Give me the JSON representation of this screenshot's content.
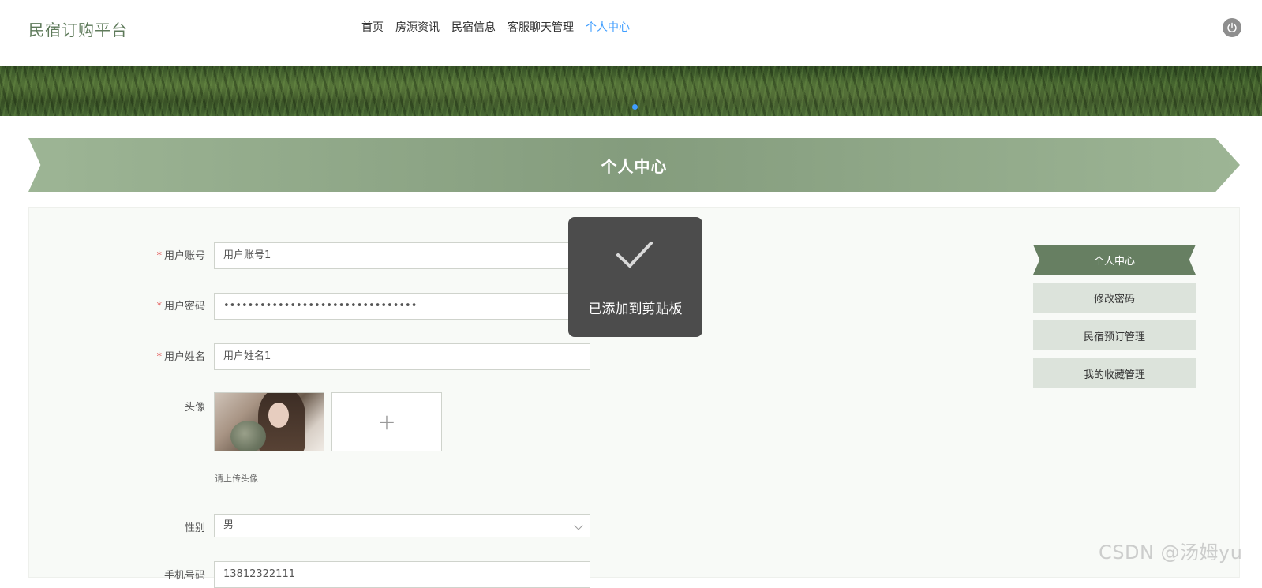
{
  "header": {
    "logo": "民宿订购平台",
    "nav": [
      "首页",
      "房源资讯",
      "民宿信息",
      "客服聊天管理",
      "个人中心"
    ],
    "active_nav": "个人中心"
  },
  "page_title": "个人中心",
  "form": {
    "fields": [
      {
        "label": "用户账号",
        "required": true,
        "value": "用户账号1"
      },
      {
        "label": "用户密码",
        "required": true,
        "value": "••••••••••••••••••••••••••••••••"
      },
      {
        "label": "用户姓名",
        "required": true,
        "value": "用户姓名1"
      }
    ],
    "avatar_label": "头像",
    "avatar_hint": "请上传头像",
    "uploader_plus": "+",
    "gender_label": "性别",
    "gender_value": "男",
    "phone_label": "手机号码",
    "phone_value": "13812322111"
  },
  "sidebar": {
    "items": [
      "个人中心",
      "修改密码",
      "民宿预订管理",
      "我的收藏管理"
    ]
  },
  "toast": {
    "message": "已添加到剪贴板",
    "icon": "check-icon"
  },
  "watermark": "CSDN @汤姆yu",
  "colors": {
    "brand": "#5e7a5a",
    "active_nav": "#409eff",
    "menu_active": "#677f62",
    "menu_bg": "#dce3db",
    "toast_bg": "#4c4c4c"
  }
}
